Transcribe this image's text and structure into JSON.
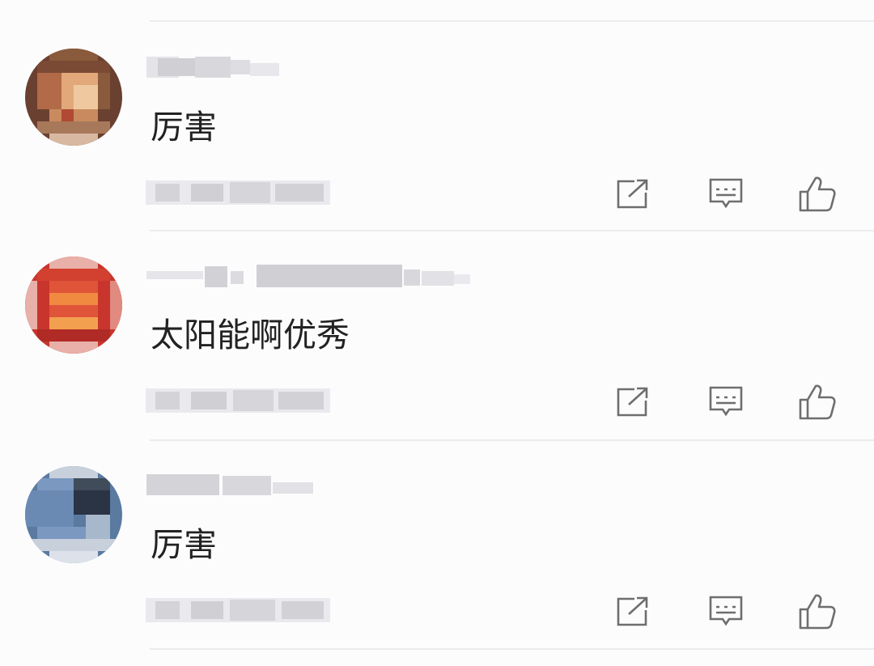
{
  "comments": [
    {
      "text": "厉害",
      "avatar_colors": [
        "#8a5a3c",
        "#c88a5e",
        "#e2a87a",
        "#6a4030",
        "#b26a48",
        "#f0c8a0"
      ],
      "actions": [
        "share-icon",
        "reply-icon",
        "like-icon"
      ]
    },
    {
      "text": "太阳能啊优秀",
      "avatar_colors": [
        "#c8352c",
        "#e0543a",
        "#f08a40",
        "#b02a26",
        "#e8b0a8",
        "#f2a050"
      ],
      "actions": [
        "share-icon",
        "reply-icon",
        "like-icon"
      ]
    },
    {
      "text": "厉害",
      "avatar_colors": [
        "#5a7aa0",
        "#7a98c0",
        "#2a3444",
        "#a8b8cc",
        "#404c5a",
        "#c8d0dc"
      ],
      "actions": [
        "share-icon",
        "reply-icon",
        "like-icon"
      ]
    }
  ],
  "colors": {
    "background": "#fcfcfd",
    "divider": "#ececef",
    "text": "#222222",
    "icon": "#6e6e6e",
    "blurred_text": "#d0d0d4"
  }
}
